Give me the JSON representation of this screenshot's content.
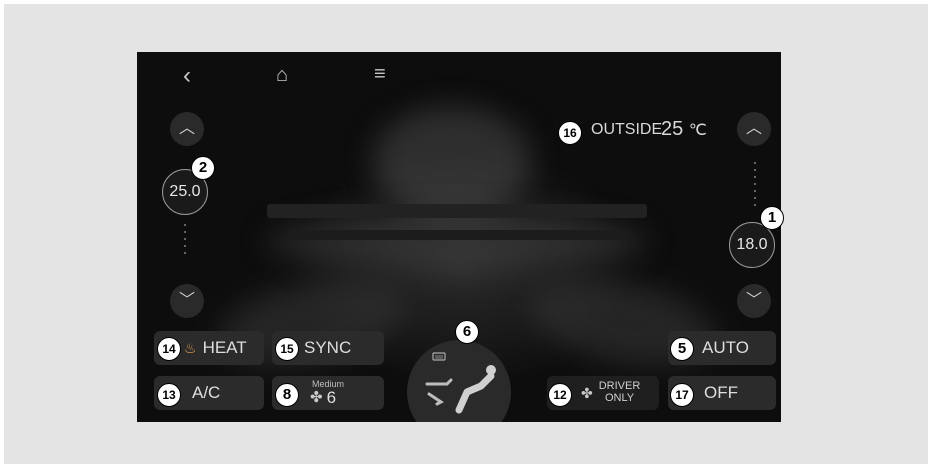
{
  "nav": {
    "back_glyph": "‹",
    "home_glyph": "⌂",
    "menu_glyph": "≡"
  },
  "outside": {
    "label": "OUTSIDE",
    "value": "25",
    "unit": "℃"
  },
  "left_temp": {
    "value": "25.0",
    "up_glyph": "︿",
    "down_glyph": "﹀"
  },
  "right_temp": {
    "value": "18.0",
    "up_glyph": "︿",
    "down_glyph": "﹀"
  },
  "buttons": {
    "heat": {
      "label": "HEAT",
      "icon": "seat-heat-icon"
    },
    "sync": {
      "label": "SYNC"
    },
    "auto": {
      "label": "AUTO"
    },
    "ac": {
      "label": "A/C"
    },
    "fan": {
      "level_name": "Medium",
      "level": "6",
      "icon": "fan-icon"
    },
    "driver_only": {
      "line1": "DRIVER",
      "line2": "ONLY",
      "icon": "fan-icon"
    },
    "off": {
      "label": "OFF"
    }
  },
  "callouts": {
    "n1": "1",
    "n2": "2",
    "n5": "5",
    "n6": "6",
    "n8": "8",
    "n12": "12",
    "n13": "13",
    "n14": "14",
    "n15": "15",
    "n16": "16",
    "n17": "17"
  },
  "colors": {
    "background": "#e4e4e4",
    "screen": "#111111",
    "button": "#2b2b2b",
    "text": "#dedede"
  }
}
